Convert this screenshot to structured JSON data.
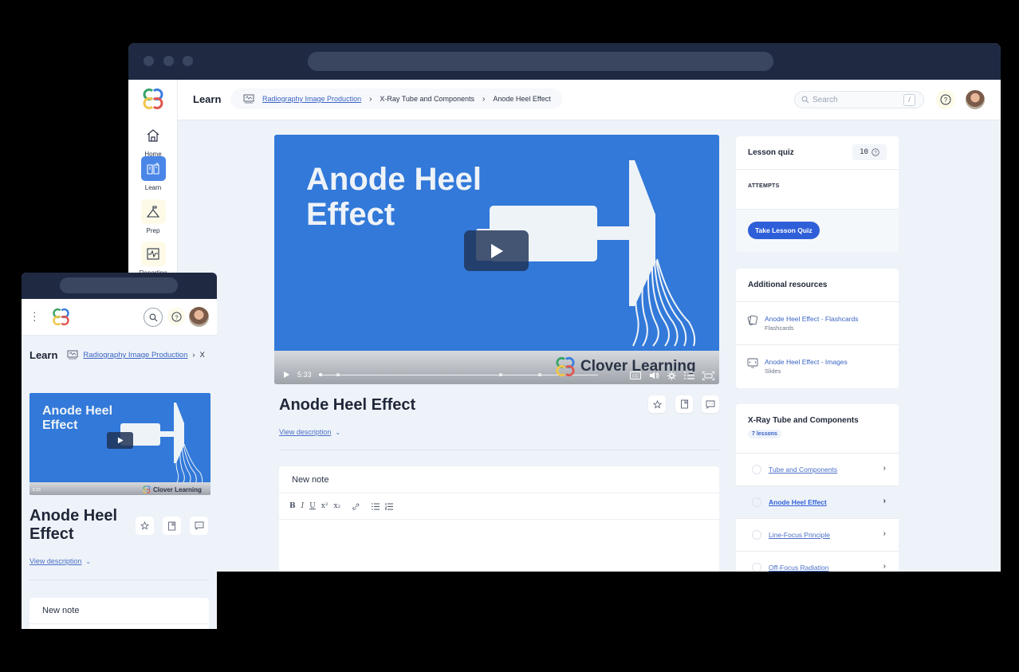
{
  "desktop": {
    "sidebar": {
      "items": [
        {
          "label": "Home",
          "icon": "home-icon"
        },
        {
          "label": "Learn",
          "icon": "learn-book-icon",
          "active": true
        },
        {
          "label": "Prep",
          "icon": "mountain-flag-icon"
        },
        {
          "label": "Reporting",
          "icon": "chart-monitor-icon"
        }
      ]
    },
    "topbar": {
      "title": "Learn",
      "breadcrumb": [
        {
          "label": "Radiography Image Production",
          "link": true
        },
        {
          "label": "X-Ray Tube and Components",
          "link": false
        },
        {
          "label": "Anode Heel Effect",
          "link": false
        }
      ],
      "search_placeholder": "Search",
      "search_shortcut": "/"
    },
    "video": {
      "title_line1": "Anode Heel",
      "title_line2": "Effect",
      "time": "5:33",
      "brand": "Clover Learning",
      "progress": 0.0
    },
    "lesson": {
      "title": "Anode Heel Effect",
      "view_description": "View description"
    },
    "note": {
      "title": "New note",
      "toolbar": [
        "B",
        "I",
        "U",
        "x²",
        "x₂",
        "link",
        "bullet-list",
        "numbered-list"
      ]
    },
    "quiz": {
      "title": "Lesson quiz",
      "count": "10",
      "attempts_label": "ATTEMPTS",
      "button": "Take Lesson Quiz"
    },
    "resources": {
      "title": "Additional resources",
      "items": [
        {
          "title": "Anode Heel Effect - Flashcards",
          "type": "Flashcards"
        },
        {
          "title": "Anode Heel Effect - Images",
          "type": "Slides"
        }
      ]
    },
    "module": {
      "title": "X-Ray Tube and Components",
      "lessons_badge": "7 lessons",
      "lessons": [
        {
          "label": "Tube and Components",
          "active": false
        },
        {
          "label": "Anode Heel Effect",
          "active": true
        },
        {
          "label": "Line-Focus Principle",
          "active": false
        },
        {
          "label": "Off-Focus Radiation",
          "active": false
        }
      ]
    }
  },
  "mobile": {
    "title": "Learn",
    "breadcrumb_link": "Radiography Image Production",
    "breadcrumb_next": "X",
    "video_title_line1": "Anode Heel",
    "video_title_line2": "Effect",
    "video_time": "5:33",
    "brand": "Clover Learning",
    "lesson_title": "Anode Heel Effect",
    "view_description": "View description",
    "note_title": "New note"
  },
  "colors": {
    "accent": "#2f5fd8",
    "video_bg": "#3279d9",
    "chrome": "#1f2942",
    "logo": [
      "#3aa46b",
      "#3b7ee0",
      "#f2c64a",
      "#e0574f"
    ]
  }
}
